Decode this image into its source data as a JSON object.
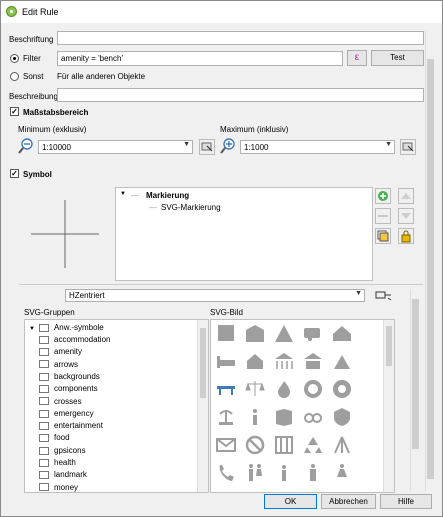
{
  "window": {
    "title": "Edit Rule"
  },
  "rule": {
    "label_caption": "Beschriftung",
    "label_value": "",
    "filter_label": "Filter",
    "filter_value": "amenity = 'bench'",
    "epsilon_label": "ε",
    "test_label": "Test",
    "else_label": "Sonst",
    "else_desc": "Für alle anderen Objekte",
    "description_caption": "Beschreibung",
    "description_value": ""
  },
  "scale": {
    "title": "Maßstabsbereich",
    "min_caption": "Minimum (exklusiv)",
    "min_value": "1:10000",
    "max_caption": "Maximum (inklusiv)",
    "max_value": "1:1000"
  },
  "symbol": {
    "title": "Symbol",
    "tree": [
      "Markierung",
      "SVG-Markierung"
    ]
  },
  "svg": {
    "anchor_value": "HZentriert",
    "groups_caption": "SVG-Gruppen",
    "image_caption": "SVG-Bild",
    "group_root": "Anw.-symbole",
    "groups": [
      "accommodation",
      "amenity",
      "arrows",
      "backgrounds",
      "components",
      "crosses",
      "emergency",
      "entertainment",
      "food",
      "gpsicons",
      "health",
      "landmark",
      "money"
    ]
  },
  "footer": {
    "ok_label": "OK",
    "cancel_label": "Abbrechen",
    "help_label": "Hilfe"
  },
  "colors": {
    "accent_green": "#4caf50",
    "preview_blue": "#3d7ab8",
    "svg_gray": "#9e9e9e"
  }
}
